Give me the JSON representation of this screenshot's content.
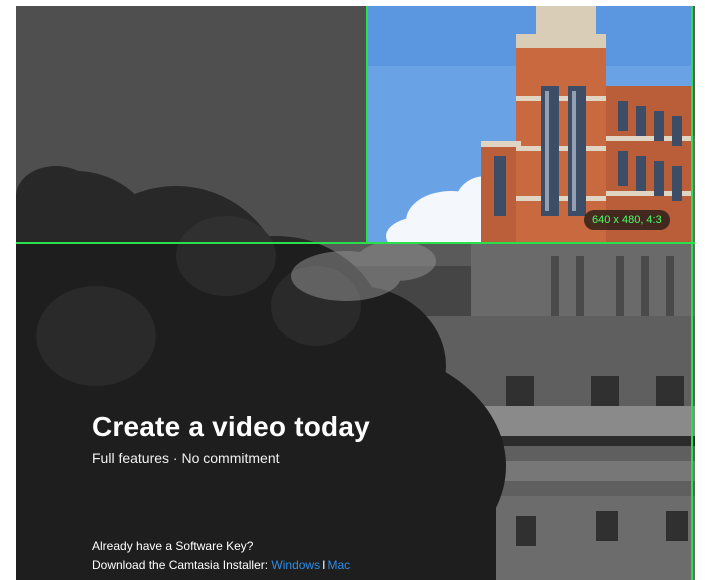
{
  "overlay": {
    "size_badge": "640 x 480, 4:3",
    "guide_color": "#28e04a"
  },
  "hero": {
    "title": "Create a video today",
    "subtitle": "Full features · No commitment"
  },
  "download": {
    "question": "Already have a Software Key?",
    "prefix": "Download the Camtasia Installer: ",
    "windows_label": "Windows",
    "separator": "I",
    "mac_label": "Mac",
    "link_color": "#2f8de6"
  }
}
